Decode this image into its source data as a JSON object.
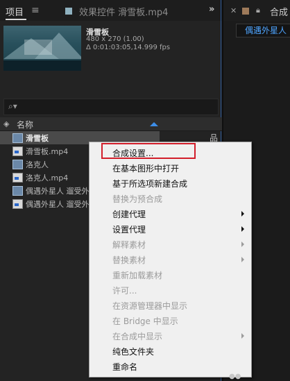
{
  "tabs": {
    "project": "项目",
    "menu_icon": "hamburger-icon",
    "effects": "效果控件 滑雪板.mp4",
    "expand_icon": "double-chevron-right-icon",
    "close_icon": "close-icon",
    "lock_icon": "lock-icon",
    "composition": "合成",
    "composition_title": "偶遇外星人"
  },
  "preview": {
    "name": "滑雪板",
    "size": "480 x 270 (1.00)",
    "duration": "Δ 0:01:03:05,14.999 fps"
  },
  "search": {
    "icon": "search-icon"
  },
  "columns": {
    "name": "名称"
  },
  "items": [
    {
      "label": "滑雪板",
      "type": "composition",
      "selected": true
    },
    {
      "label": "滑雪板.mp4",
      "type": "video"
    },
    {
      "label": "洛克人",
      "type": "composition"
    },
    {
      "label": "洛克人.mp4",
      "type": "video"
    },
    {
      "label": "偶遇外星人  遛受外",
      "type": "composition"
    },
    {
      "label": "偶遇外星人  遛受外",
      "type": "video"
    }
  ],
  "context_menu": [
    {
      "label": "合成设置...",
      "enabled": true,
      "highlighted": true
    },
    {
      "label": "在基本图形中打开",
      "enabled": true
    },
    {
      "label": "基于所选项新建合成",
      "enabled": true
    },
    {
      "label": "替换为预合成",
      "enabled": false
    },
    {
      "label": "创建代理",
      "enabled": true,
      "submenu": true
    },
    {
      "label": "设置代理",
      "enabled": true,
      "submenu": true
    },
    {
      "label": "解释素材",
      "enabled": false,
      "submenu": true
    },
    {
      "label": "替换素材",
      "enabled": false,
      "submenu": true
    },
    {
      "label": "重新加载素材",
      "enabled": false
    },
    {
      "label": "许可...",
      "enabled": false
    },
    {
      "label": "在资源管理器中显示",
      "enabled": false
    },
    {
      "label": "在 Bridge 中显示",
      "enabled": false
    },
    {
      "label": "在合成中显示",
      "enabled": false,
      "submenu": true
    },
    {
      "label": "纯色文件夹",
      "enabled": true
    },
    {
      "label": "重命名",
      "enabled": true
    }
  ],
  "colors": {
    "highlight_border": "#d21d2a",
    "accent_blue": "#3d8ee8",
    "menu_bg": "#f0f0f0"
  }
}
